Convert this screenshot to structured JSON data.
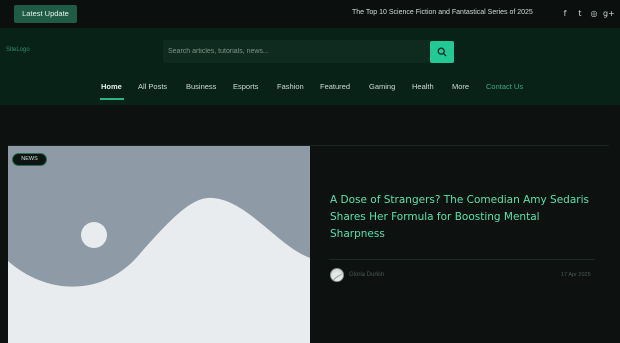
{
  "topbar": {
    "latest_label": "Latest Update",
    "ticker": "The Top 10 Science Fiction and Fantastical Series of 2025",
    "social": [
      {
        "icon": "facebook-icon",
        "glyph": "f"
      },
      {
        "icon": "twitter-icon",
        "glyph": "t"
      },
      {
        "icon": "instagram-icon",
        "glyph": "◎"
      },
      {
        "icon": "google-plus-icon",
        "glyph": "g+"
      }
    ]
  },
  "header": {
    "logo": "SiteLogo",
    "search": {
      "placeholder": "Search articles, tutorials, news...",
      "value": ""
    }
  },
  "nav": {
    "items": [
      "Home",
      "All Posts",
      "Business",
      "Esports",
      "Fashion",
      "Featured",
      "Gaming",
      "Health",
      "More",
      "Contact Us"
    ],
    "active": "Home"
  },
  "featured": {
    "badge": "NEWS",
    "title": "A Dose of Strangers? The Comedian Amy Sedaris Shares Her Formula for Boosting Mental Sharpness",
    "author": "Gloria Durkin",
    "date": "17 Apr 2025"
  },
  "colors": {
    "accent": "#22c994",
    "headline": "#55e3aa",
    "header_bg": "#092217",
    "page_bg": "#0d1110"
  }
}
